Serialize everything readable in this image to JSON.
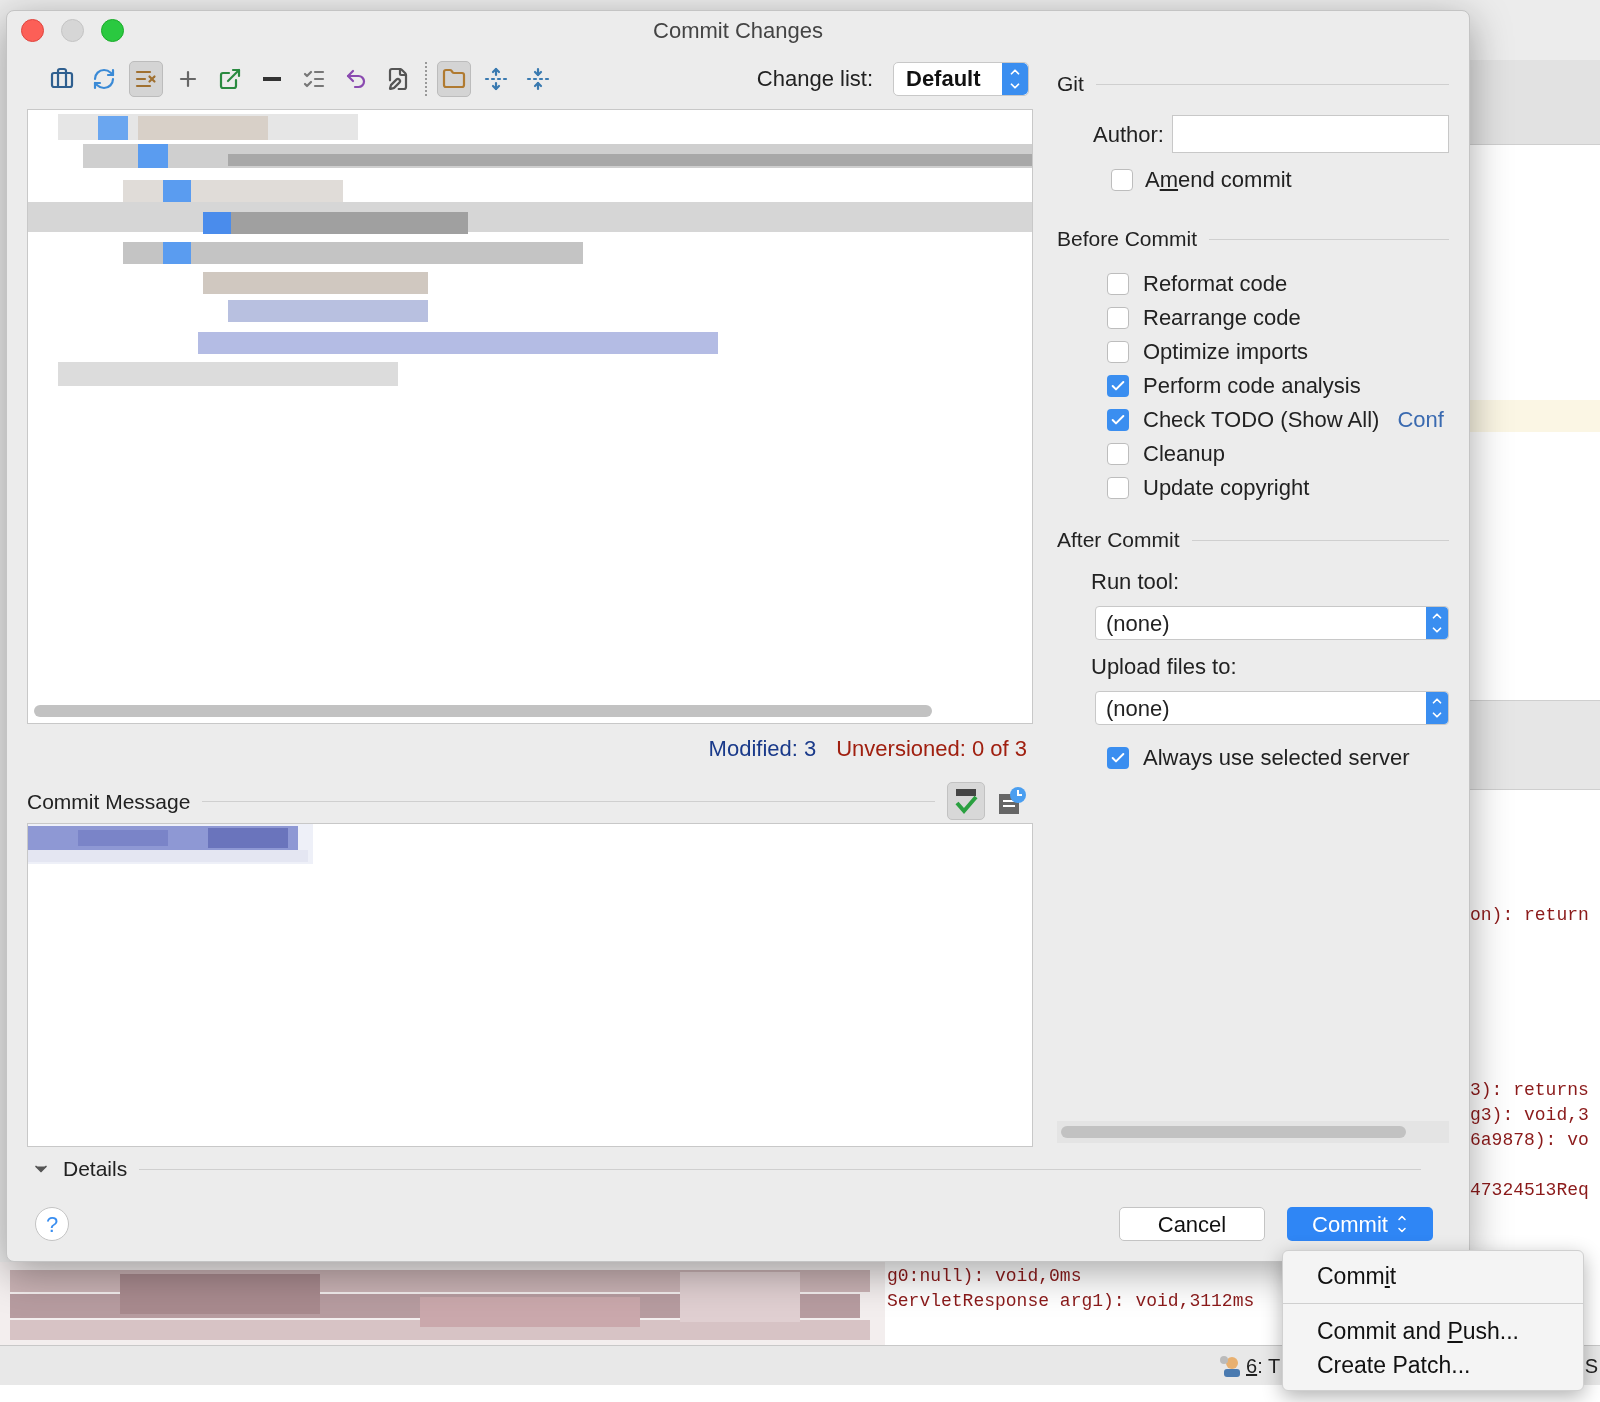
{
  "window": {
    "title": "Commit Changes"
  },
  "toolbar": {
    "buttons": [
      {
        "kind": "briefcase",
        "selected": false
      },
      {
        "kind": "refresh",
        "selected": false
      },
      {
        "kind": "list-x",
        "selected": true
      },
      {
        "kind": "plus",
        "selected": false
      },
      {
        "kind": "move",
        "selected": false
      },
      {
        "kind": "minus",
        "selected": false
      },
      {
        "kind": "checklist",
        "selected": false
      },
      {
        "kind": "undo",
        "selected": false
      },
      {
        "kind": "edit",
        "selected": false
      },
      {
        "kind": "separator"
      },
      {
        "kind": "folder",
        "selected": true
      },
      {
        "kind": "expand",
        "selected": false
      },
      {
        "kind": "collapse",
        "selected": false
      }
    ],
    "change_list": {
      "label": "Change list:",
      "value": "Default"
    }
  },
  "summary": {
    "modified": "Modified: 3",
    "unversioned": "Unversioned: 0 of 3"
  },
  "commit_message": {
    "label": "Commit Message"
  },
  "details": {
    "label": "Details",
    "expanded": true
  },
  "git": {
    "title": "Git",
    "author_label": "Author:",
    "amend": {
      "parts": [
        "A",
        "m",
        "end commit"
      ],
      "checked": false
    }
  },
  "before_commit": {
    "title": "Before Commit",
    "options": [
      {
        "label": "Reformat code",
        "checked": false
      },
      {
        "label": "Rearrange code",
        "checked": false
      },
      {
        "label": "Optimize imports",
        "checked": false
      },
      {
        "label": "Perform code analysis",
        "checked": true
      },
      {
        "label": "Check TODO (Show All)",
        "checked": true,
        "link": "Conf"
      },
      {
        "label": "Cleanup",
        "checked": false
      },
      {
        "label": "Update copyright",
        "checked": false
      }
    ]
  },
  "after_commit": {
    "title": "After Commit",
    "run_tool": {
      "label": "Run tool:",
      "value": "(none)"
    },
    "upload": {
      "label": "Upload files to:",
      "value": "(none)"
    },
    "always_server": {
      "label": "Always use selected server",
      "checked": true
    }
  },
  "buttons": {
    "help": "?",
    "cancel": "Cancel",
    "commit": "Commit"
  },
  "commit_menu": [
    {
      "parts": [
        "Comm",
        "i",
        "t"
      ]
    },
    {
      "parts": [
        "Commit and ",
        "P",
        "ush..."
      ]
    },
    {
      "parts": [
        "Create Patch..."
      ]
    }
  ],
  "background": {
    "console_lines": [
      "on): return",
      "3): returns",
      "g3): void,3",
      "6a9878): vo",
      "47324513Req"
    ],
    "log_lines": [
      "g0:null): void,0ms",
      "ServletResponse arg1): void,3112ms"
    ],
    "status_bar": {
      "tool_parts": [
        "6",
        ": T"
      ],
      "edge_text": "S"
    }
  }
}
